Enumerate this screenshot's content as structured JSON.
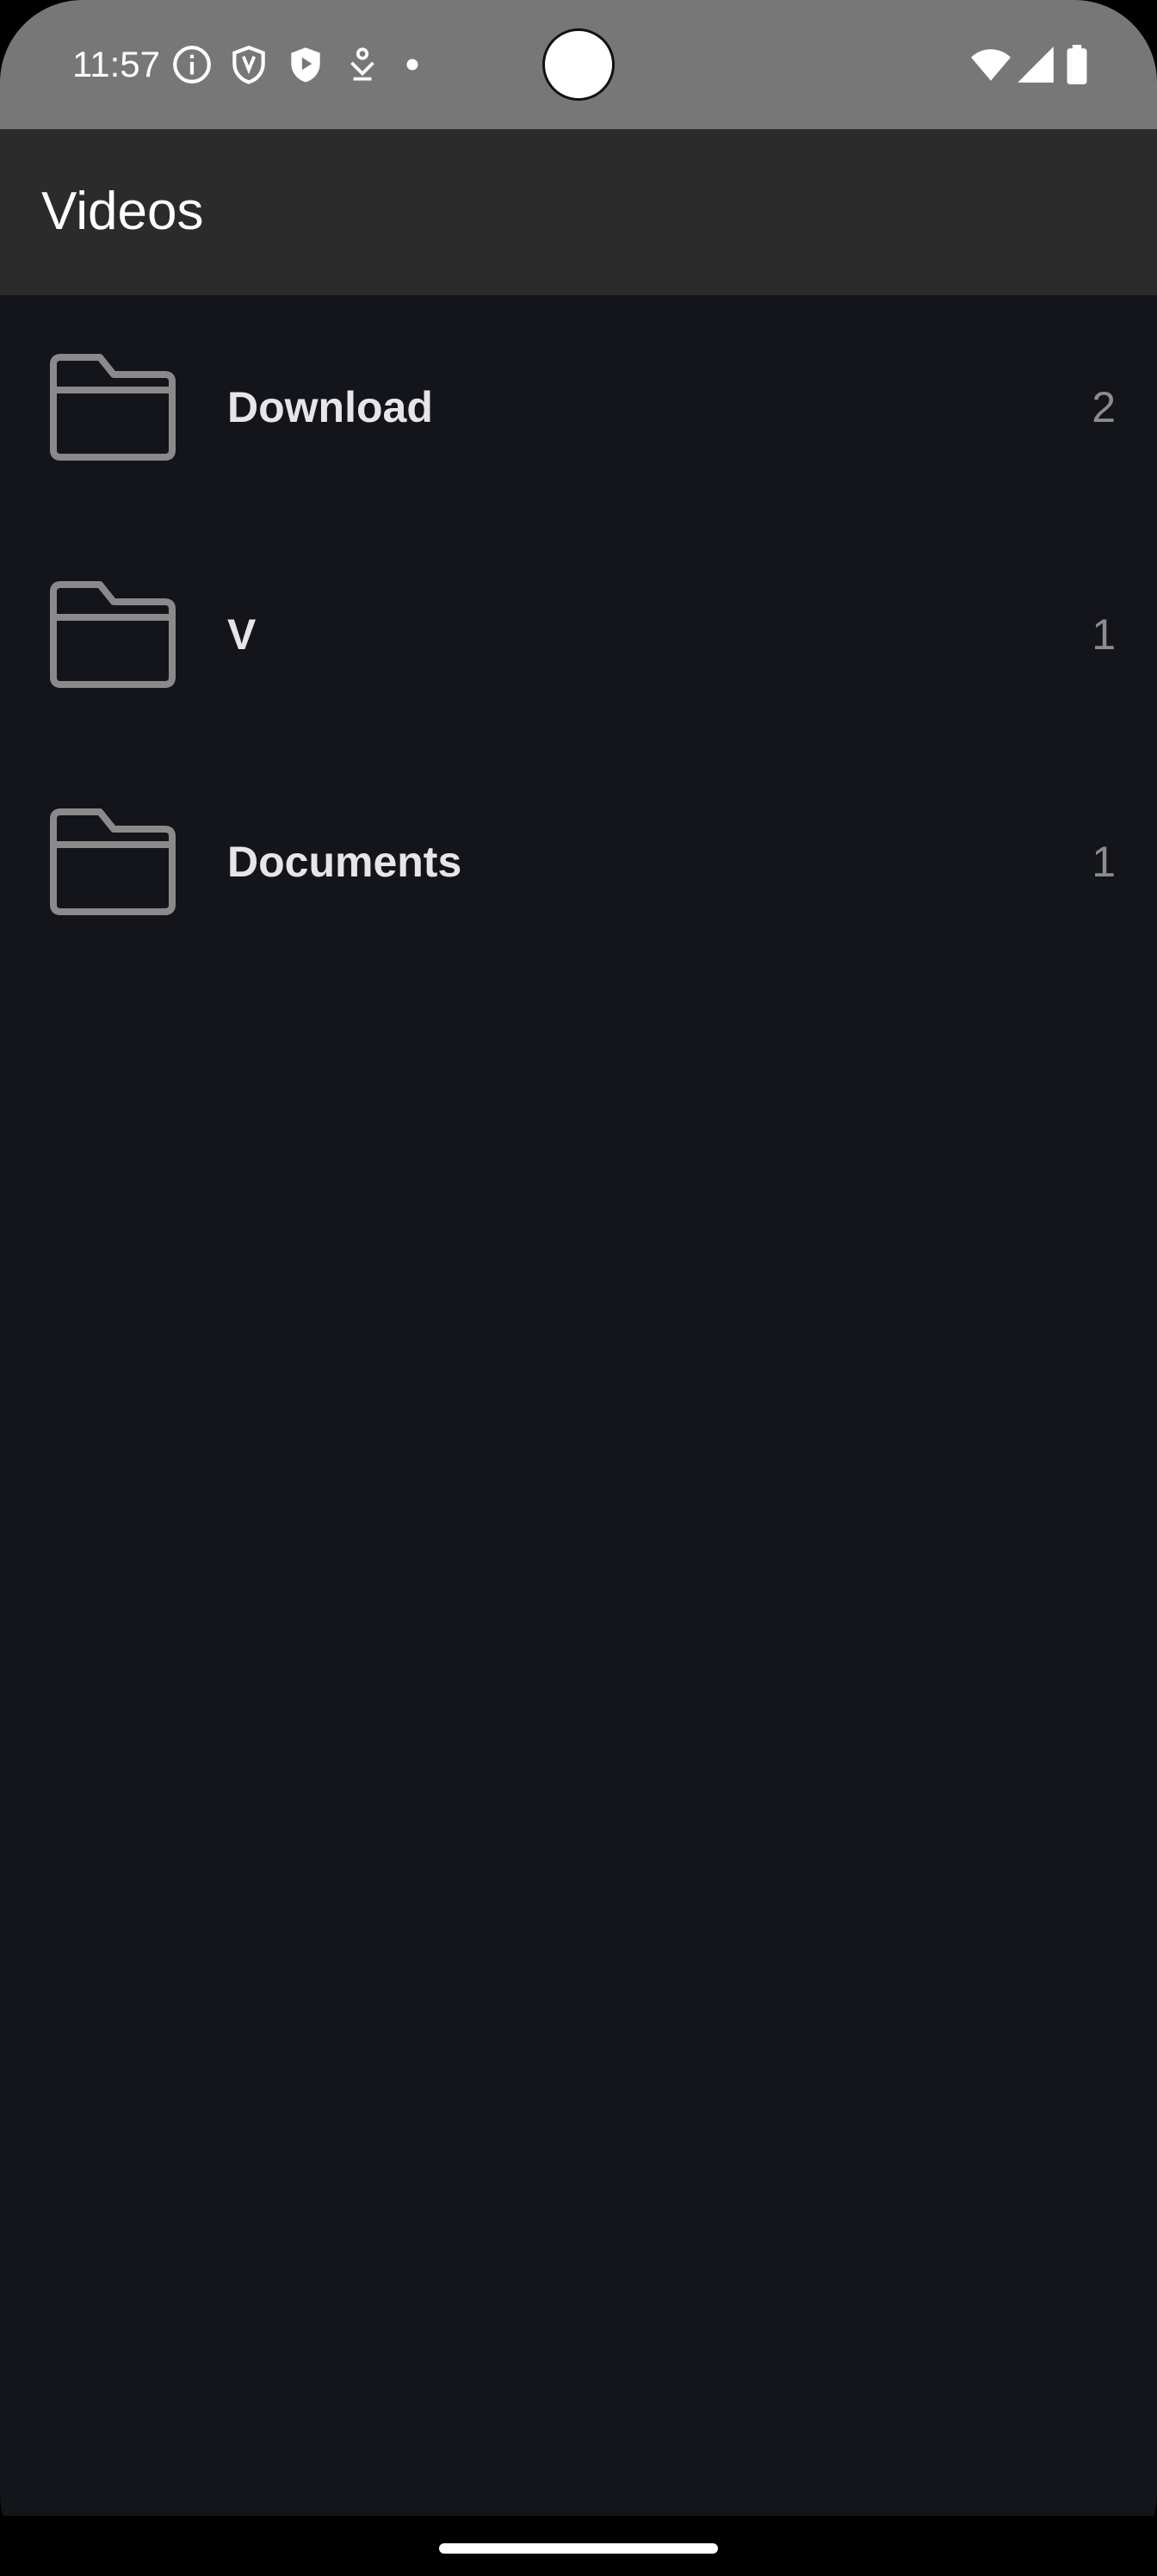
{
  "status_bar": {
    "time": "11:57",
    "icons": [
      "info-icon",
      "shield-icon",
      "play-shield-icon",
      "download-pin-icon",
      "notification-dot-icon",
      "wifi-icon",
      "cell-signal-icon",
      "battery-icon"
    ]
  },
  "app_bar": {
    "title": "Videos"
  },
  "folders": [
    {
      "name": "Download",
      "count": "2",
      "icon": "folder-icon"
    },
    {
      "name": "V",
      "count": "1",
      "icon": "folder-icon"
    },
    {
      "name": "Documents",
      "count": "1",
      "icon": "folder-icon"
    }
  ],
  "colors": {
    "status_bar_bg": "#777777",
    "app_bar_bg": "#2b2b2b",
    "content_bg": "#14151a",
    "folder_name": "#e6e6e8",
    "folder_count": "#8c8c8c",
    "folder_icon_stroke": "#8a8a8a"
  }
}
